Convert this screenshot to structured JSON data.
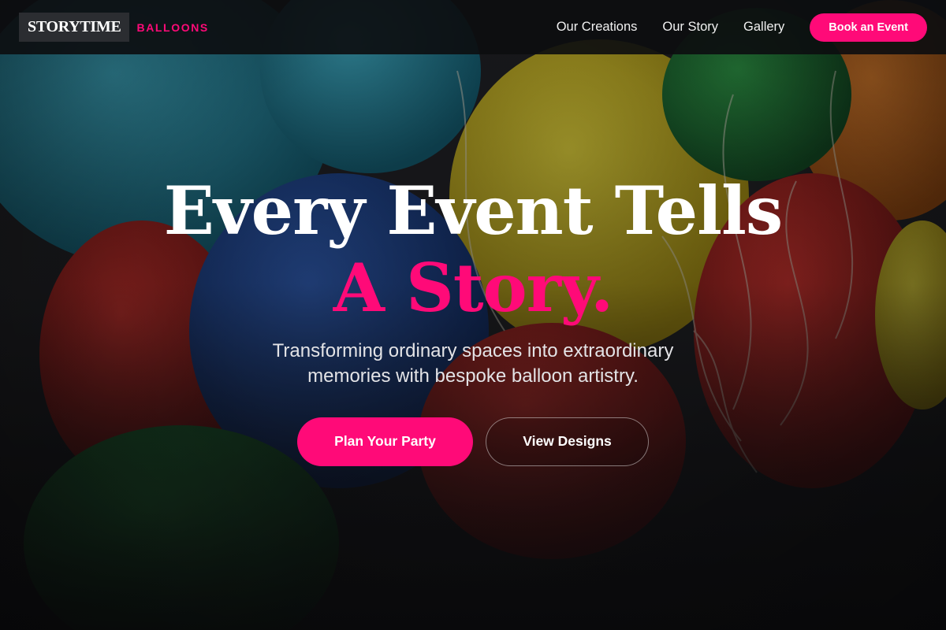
{
  "brand": {
    "name": "STORYTIME",
    "tagline": "BALLOONS",
    "accent_color": "#ff0a78"
  },
  "nav": {
    "links": [
      "Our Creations",
      "Our Story",
      "Gallery"
    ],
    "cta_label": "Book an Event"
  },
  "hero": {
    "headline_line1": "Every Event Tells",
    "headline_line2": "A Story.",
    "subtitle": "Transforming ordinary spaces into extraordinary memories with bespoke balloon artistry.",
    "primary_button": "Plan Your Party",
    "secondary_button": "View Designs",
    "background_image": "balloon-photo"
  }
}
